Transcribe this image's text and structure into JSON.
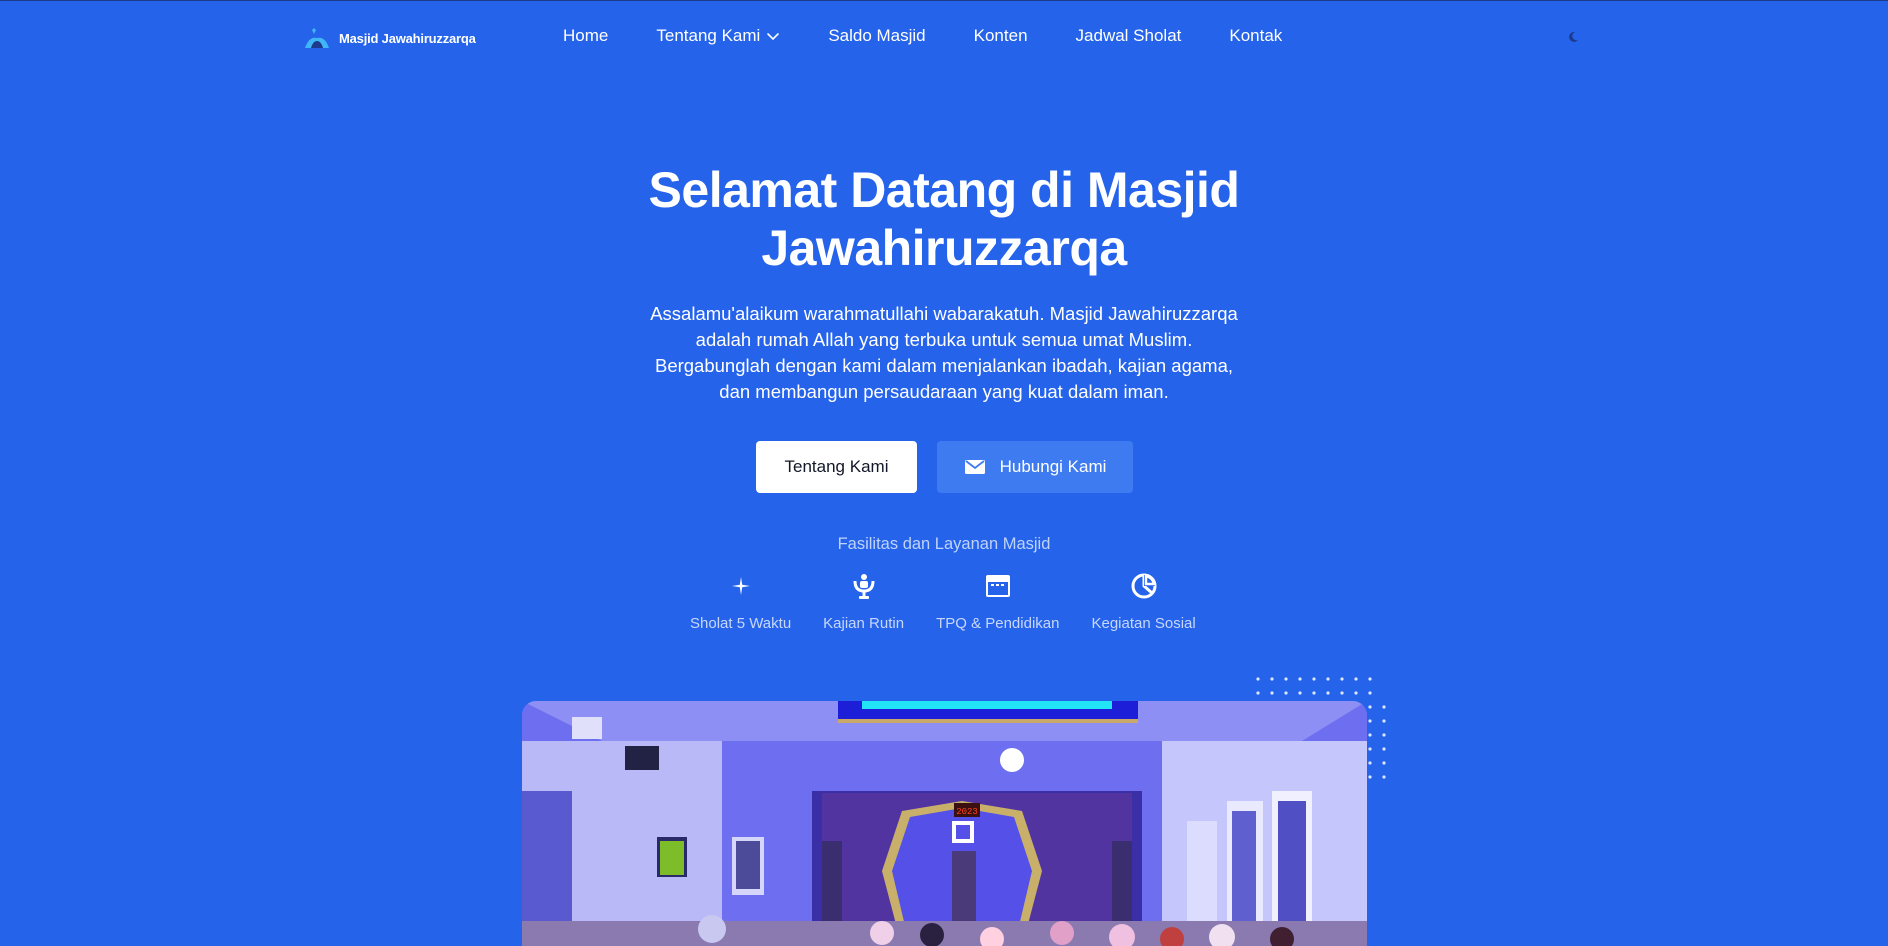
{
  "colors": {
    "background": "#2563eb",
    "button_secondary": "#3f7bf0",
    "text": "#ffffff"
  },
  "brand": {
    "name": "Masjid Jawahiruzzarqa",
    "icon": "mosque-logo-icon"
  },
  "nav": {
    "items": [
      {
        "label": "Home"
      },
      {
        "label": "Tentang Kami",
        "icon": "chevron-down-icon"
      },
      {
        "label": "Saldo Masjid"
      },
      {
        "label": "Konten"
      },
      {
        "label": "Jadwal Sholat"
      },
      {
        "label": "Kontak"
      }
    ],
    "theme_toggle_icon": "moon-icon"
  },
  "hero": {
    "title_line1": "Selamat Datang di Masjid",
    "title_line2": "Jawahiruzzarqa",
    "description": "Assalamu'alaikum warahmatullahi wabarakatuh. Masjid Jawahiruzzarqa adalah rumah Allah yang terbuka untuk semua umat Muslim. Bergabunglah dengan kami dalam menjalankan ibadah, kajian agama, dan membangun persaudaraan yang kuat dalam iman.",
    "primary_button": "Tentang Kami",
    "secondary_button": "Hubungi Kami",
    "secondary_button_icon": "mail-icon"
  },
  "facilities": {
    "title": "Fasilitas dan Layanan Masjid",
    "items": [
      {
        "label": "Sholat 5 Waktu",
        "icon": "sparkle-icon"
      },
      {
        "label": "Kajian Rutin",
        "icon": "microphone-icon"
      },
      {
        "label": "TPQ & Pendidikan",
        "icon": "window-icon"
      },
      {
        "label": "Kegiatan Sosial",
        "icon": "pie-chart-icon"
      }
    ]
  },
  "image": {
    "icon": "mosque-interior-photo",
    "clock_display": "2023"
  }
}
